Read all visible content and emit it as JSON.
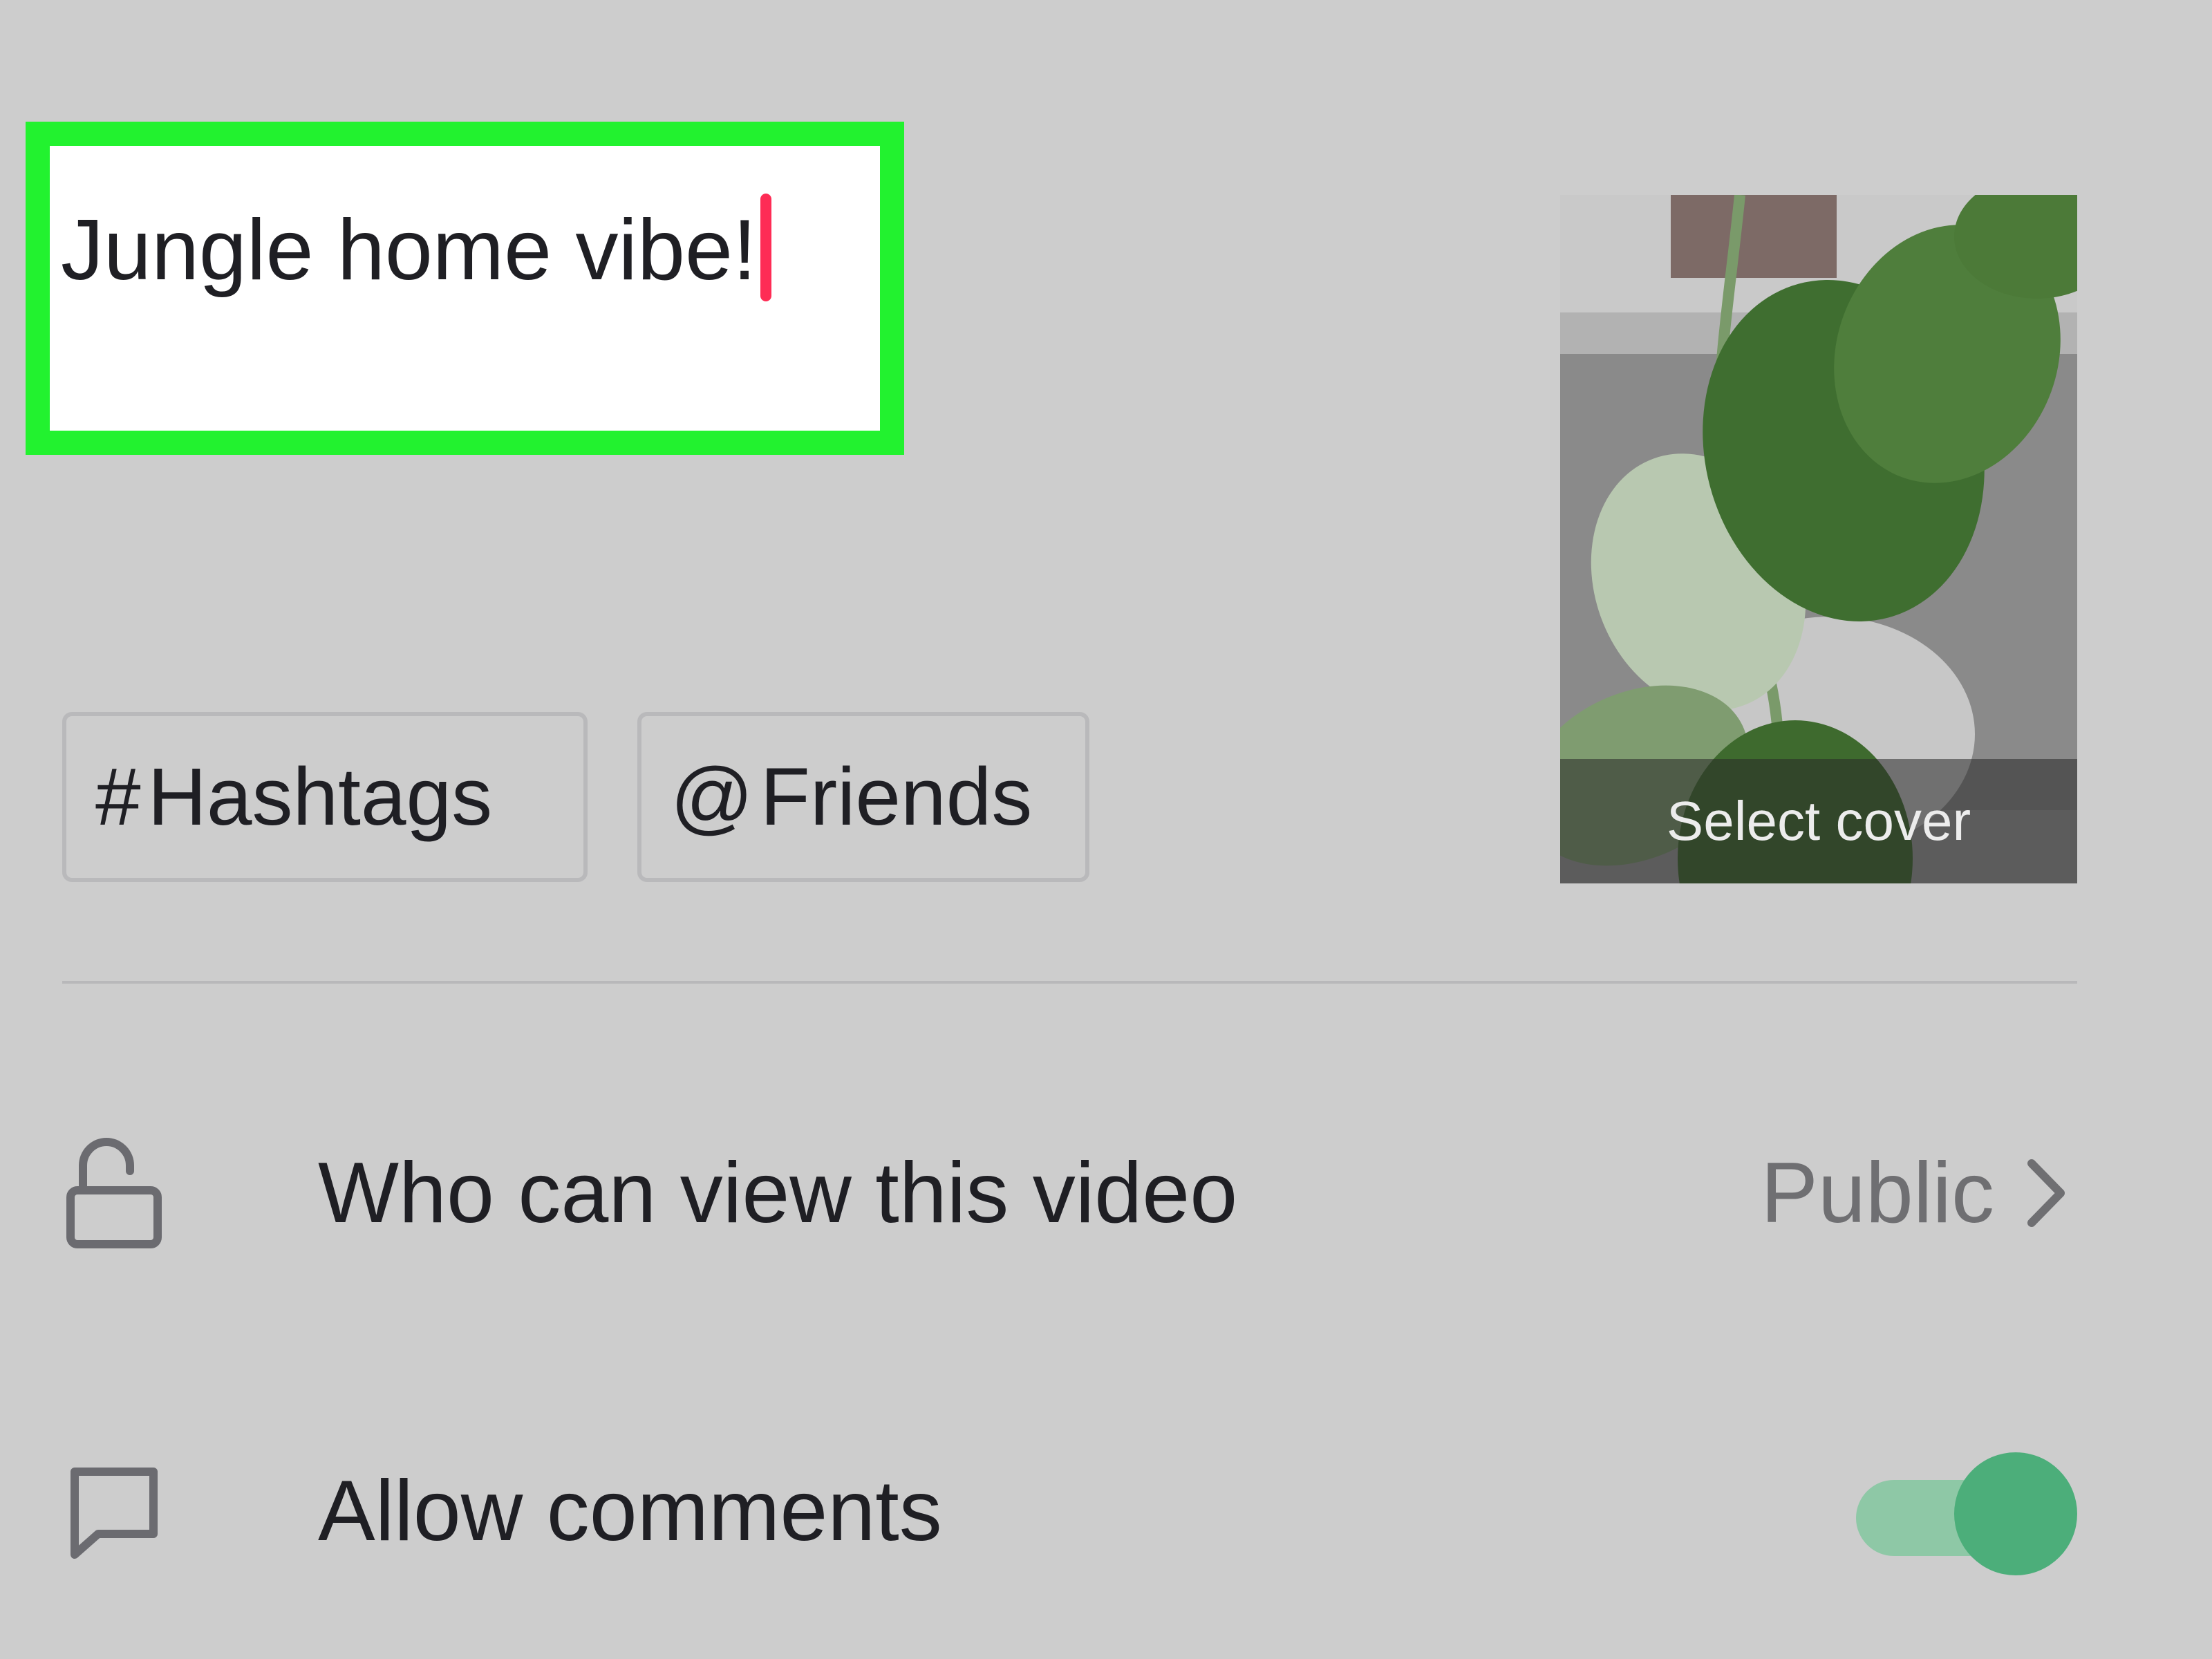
{
  "caption": {
    "text": "Jungle home vibe!"
  },
  "chips": {
    "hashtags": {
      "symbol": "#",
      "label": "Hashtags"
    },
    "friends": {
      "symbol": "@",
      "label": "Friends"
    }
  },
  "cover": {
    "label": "Select cover"
  },
  "settings": {
    "privacy": {
      "label": "Who can view this video",
      "value": "Public",
      "icon": "lock-open-icon"
    },
    "comments": {
      "label": "Allow comments",
      "icon": "comment-icon",
      "enabled": true
    }
  },
  "colors": {
    "highlight": "#22f22f",
    "caret": "#fe2c55",
    "toggle_on": "#4cae7a",
    "background": "#cdcdcd"
  }
}
